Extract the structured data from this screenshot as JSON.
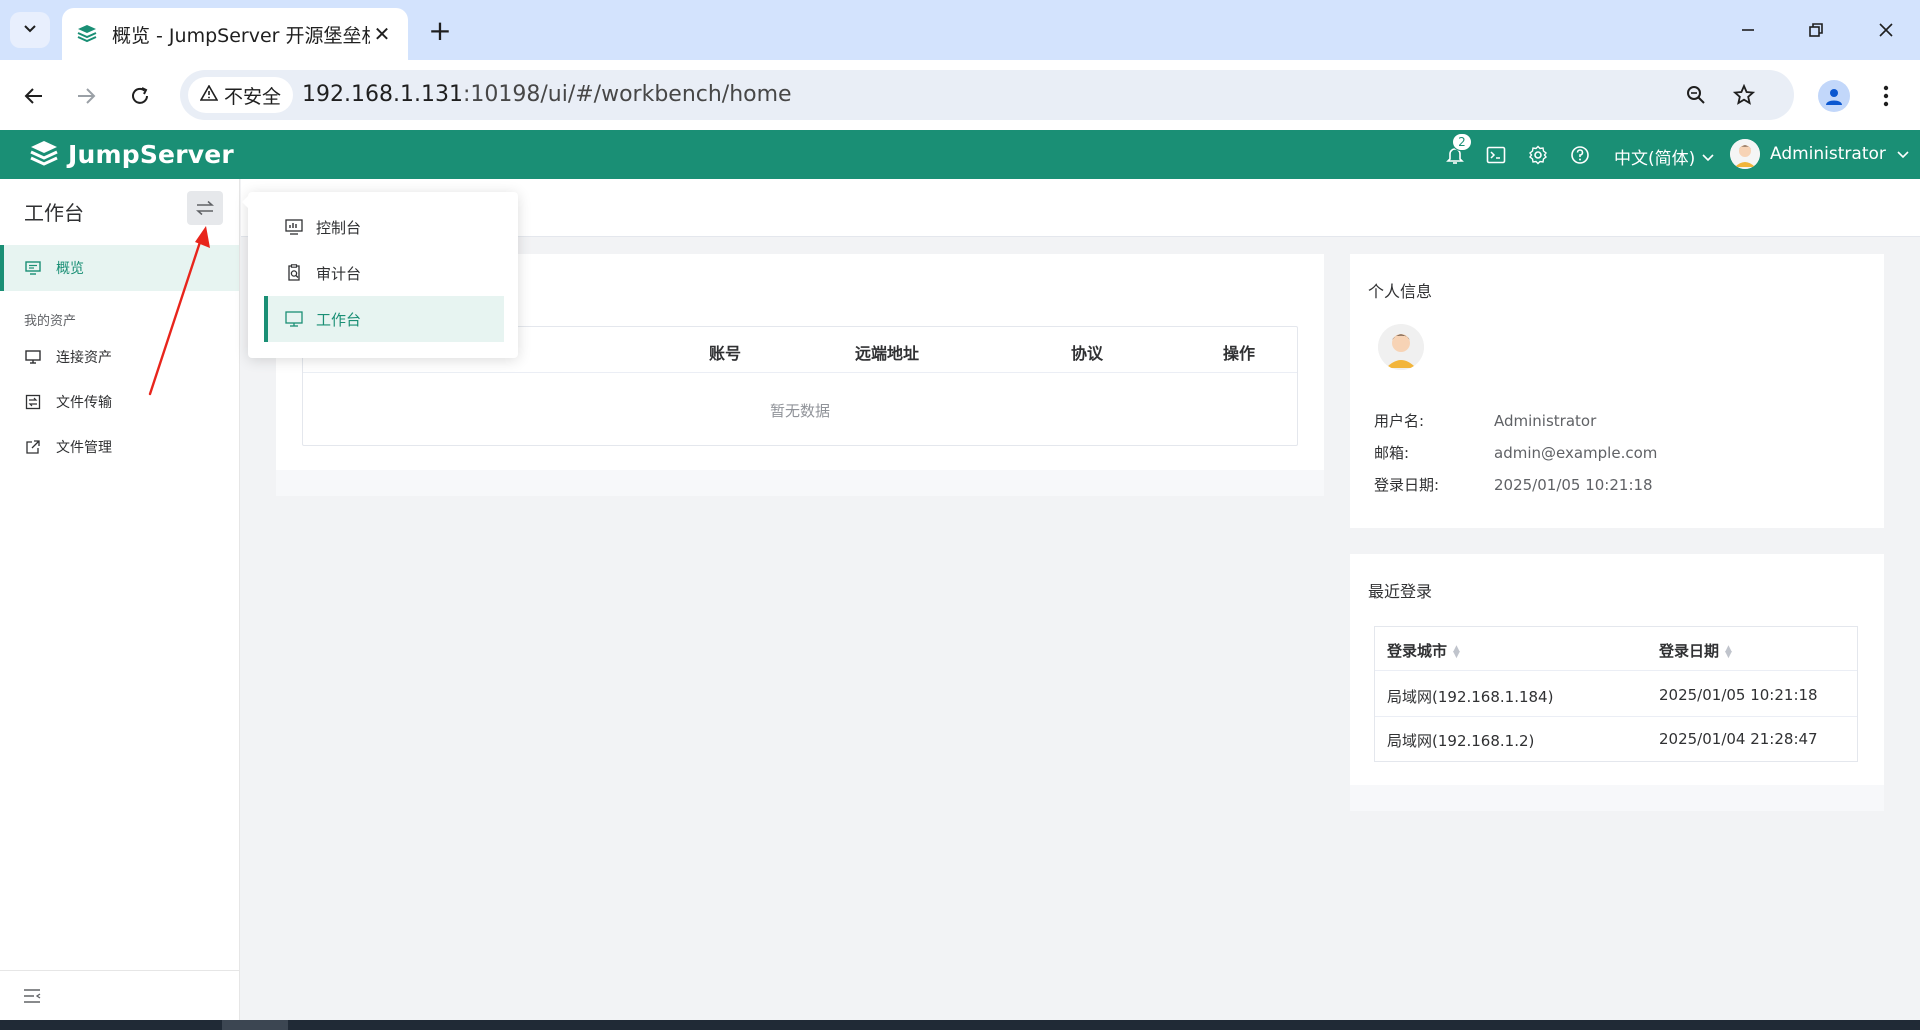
{
  "browser": {
    "tab_title": "概览 - JumpServer 开源堡垒机",
    "tab_close": "✕",
    "new_tab": "+",
    "security_label": "不安全",
    "url_host": "192.168.1.131",
    "url_rest": ":10198/ui/#/workbench/home"
  },
  "header": {
    "logo_text": "JumpServer",
    "notification_count": "2",
    "language": "中文(简体)",
    "username": "Administrator"
  },
  "sidebar": {
    "title": "工作台",
    "items": [
      {
        "label": "概览"
      },
      {
        "label": "连接资产"
      },
      {
        "label": "文件传输"
      },
      {
        "label": "文件管理"
      }
    ],
    "group_label": "我的资产"
  },
  "view_switcher": {
    "items": [
      {
        "label": "控制台"
      },
      {
        "label": "审计台"
      },
      {
        "label": "工作台"
      }
    ]
  },
  "sessions_table": {
    "columns": [
      "账号",
      "远端地址",
      "协议",
      "操作"
    ],
    "empty_text": "暂无数据"
  },
  "profile": {
    "title": "个人信息",
    "username_label": "用户名:",
    "username_value": "Administrator",
    "email_label": "邮箱:",
    "email_value": "admin@example.com",
    "login_date_label": "登录日期:",
    "login_date_value": "2025/01/05 10:21:18"
  },
  "recent_login": {
    "title": "最近登录",
    "columns": [
      "登录城市",
      "登录日期"
    ],
    "rows": [
      {
        "city": "局域网(192.168.1.184)",
        "date": "2025/01/05 10:21:18"
      },
      {
        "city": "局域网(192.168.1.2)",
        "date": "2025/01/04 21:28:47"
      }
    ]
  },
  "colors": {
    "brand": "#1a8f75",
    "active_bg": "#e7f4f1",
    "annotation": "#e8251c"
  }
}
